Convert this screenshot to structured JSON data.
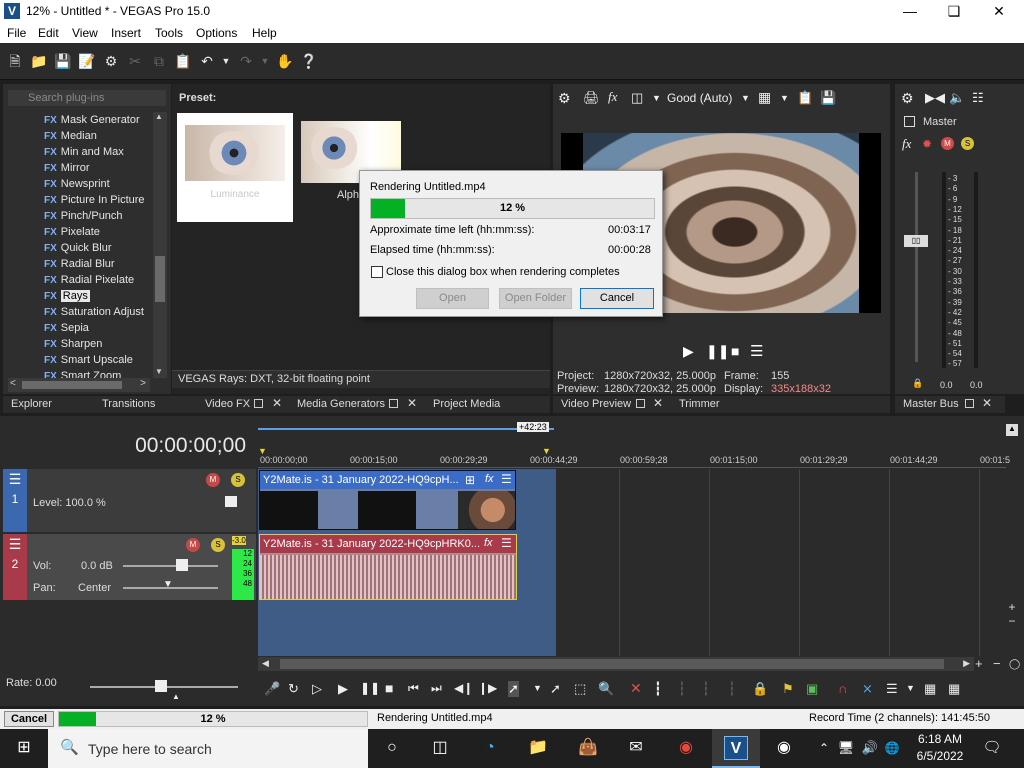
{
  "window": {
    "title": "12% - Untitled * - VEGAS Pro 15.0",
    "app_icon": "V"
  },
  "menu": [
    "File",
    "Edit",
    "View",
    "Insert",
    "Tools",
    "Options",
    "Help"
  ],
  "plugins": {
    "search_placeholder": "Search plug-ins",
    "items": [
      "Mask Generator",
      "Median",
      "Min and Max",
      "Mirror",
      "Newsprint",
      "Picture In Picture",
      "Pinch/Punch",
      "Pixelate",
      "Quick Blur",
      "Radial Blur",
      "Radial Pixelate",
      "Rays",
      "Saturation Adjust",
      "Sepia",
      "Sharpen",
      "Smart Upscale",
      "Smart Zoom"
    ],
    "selected": "Rays",
    "fx_badge": "FX"
  },
  "preset": {
    "header": "Preset:",
    "thumbs": [
      "Luminance",
      "Alpha"
    ],
    "status": "VEGAS Rays: DXT, 32-bit floating point"
  },
  "left_tabs": [
    "Explorer",
    "Transitions",
    "Video FX",
    "Media Generators",
    "Project Media"
  ],
  "preview": {
    "quality": "Good (Auto)",
    "project_label": "Project:",
    "project_value": "1280x720x32, 25.000p",
    "preview_label": "Preview:",
    "preview_value": "1280x720x32, 25.000p",
    "frame_label": "Frame:",
    "frame_value": "155",
    "display_label": "Display:",
    "display_value": "335x188x32",
    "tabs": [
      "Video Preview",
      "Trimmer"
    ]
  },
  "master": {
    "title": "Master",
    "tab": "Master Bus",
    "scale": [
      "3",
      "6",
      "9",
      "12",
      "15",
      "18",
      "21",
      "24",
      "27",
      "30",
      "33",
      "36",
      "39",
      "42",
      "45",
      "48",
      "51",
      "54",
      "57"
    ],
    "left_value": "0.0",
    "right_value": "0.0"
  },
  "dialog": {
    "title": "Rendering Untitled.mp4",
    "progress": 12,
    "progress_text": "12 %",
    "time_left_label": "Approximate time left (hh:mm:ss):",
    "time_left_value": "00:03:17",
    "elapsed_label": "Elapsed time (hh:mm:ss):",
    "elapsed_value": "00:00:28",
    "close_checkbox": "Close this dialog box when rendering completes",
    "close_checked": false,
    "buttons": {
      "open": "Open",
      "open_folder": "Open Folder",
      "cancel": "Cancel"
    }
  },
  "timeline": {
    "timecode": "00:00:00;00",
    "loop_badge": "+42:23",
    "ruler": [
      "00:00:00;00",
      "00:00:15;00",
      "00:00:29;29",
      "00:00:44;29",
      "00:00:59;28",
      "00:01:15;00",
      "00:01:29;29",
      "00:01:44;29",
      "00:01:5"
    ],
    "video_track": {
      "number": "1",
      "level_label": "Level: 100.0 %",
      "clip_title": "Y2Mate.is - 31 January 2022-HQ9cpH..."
    },
    "audio_track": {
      "number": "2",
      "vol_label": "Vol:",
      "vol_value": "0.0 dB",
      "pan_label": "Pan:",
      "pan_value": "Center",
      "clip_title": "Y2Mate.is - 31 January 2022-HQ9cpHRK0...",
      "meter": [
        "-3.0",
        "12",
        "24",
        "36",
        "48"
      ]
    },
    "rate": "Rate: 0.00"
  },
  "status": {
    "cancel": "Cancel",
    "progress": 12,
    "progress_text": "12 %",
    "rendering": "Rendering Untitled.mp4",
    "record_time": "Record Time (2 channels): 141:45:50"
  },
  "taskbar": {
    "search_placeholder": "Type here to search",
    "time": "6:18 AM",
    "date": "6/5/2022"
  }
}
